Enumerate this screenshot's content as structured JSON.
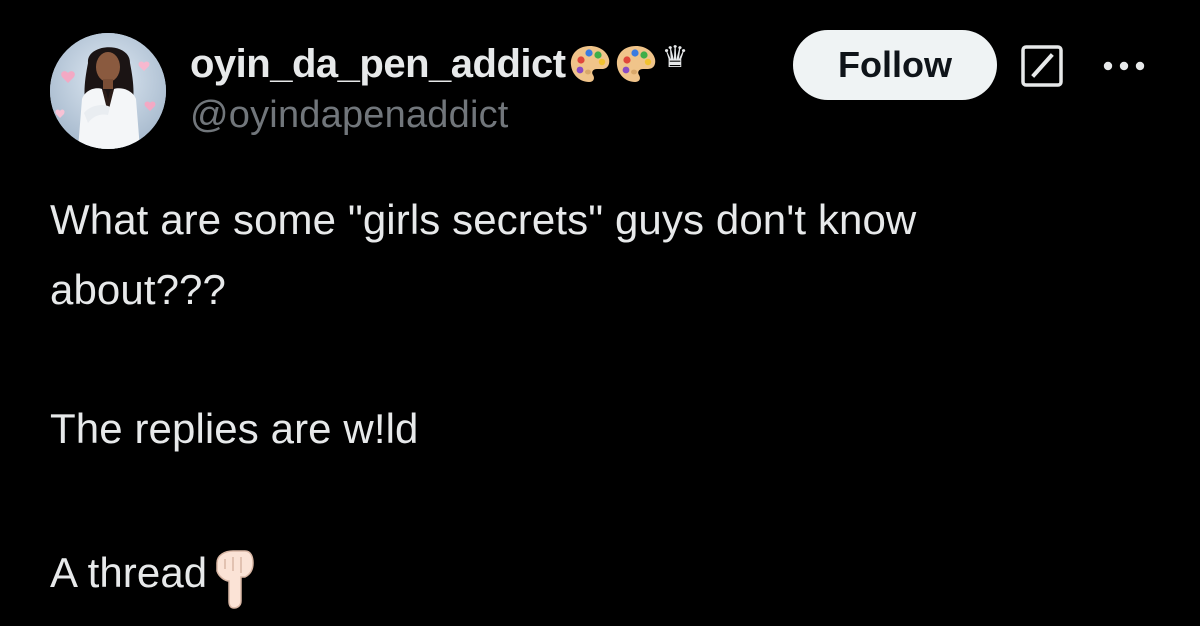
{
  "author": {
    "display_name": "oyin_da_pen_addict",
    "handle": "@oyindapenaddict",
    "name_emojis": [
      "artist-palette-icon",
      "artist-palette-icon"
    ],
    "badge_glyph": "♛"
  },
  "actions": {
    "follow_label": "Follow",
    "grok_icon": "grok-icon",
    "more_icon": "more-horizontal-icon"
  },
  "tweet": {
    "line_1": "What are some \"girls secrets\" guys don't know",
    "line_2": "about???",
    "line_3": "The replies are w!ld",
    "line_4": "A thread",
    "trailing_emoji": "backhand-index-pointing-down-icon"
  },
  "colors": {
    "background": "#000000",
    "primary_text": "#e7e9ea",
    "secondary_text": "#71767b",
    "follow_bg": "#eff3f4",
    "follow_text": "#0f1419"
  }
}
